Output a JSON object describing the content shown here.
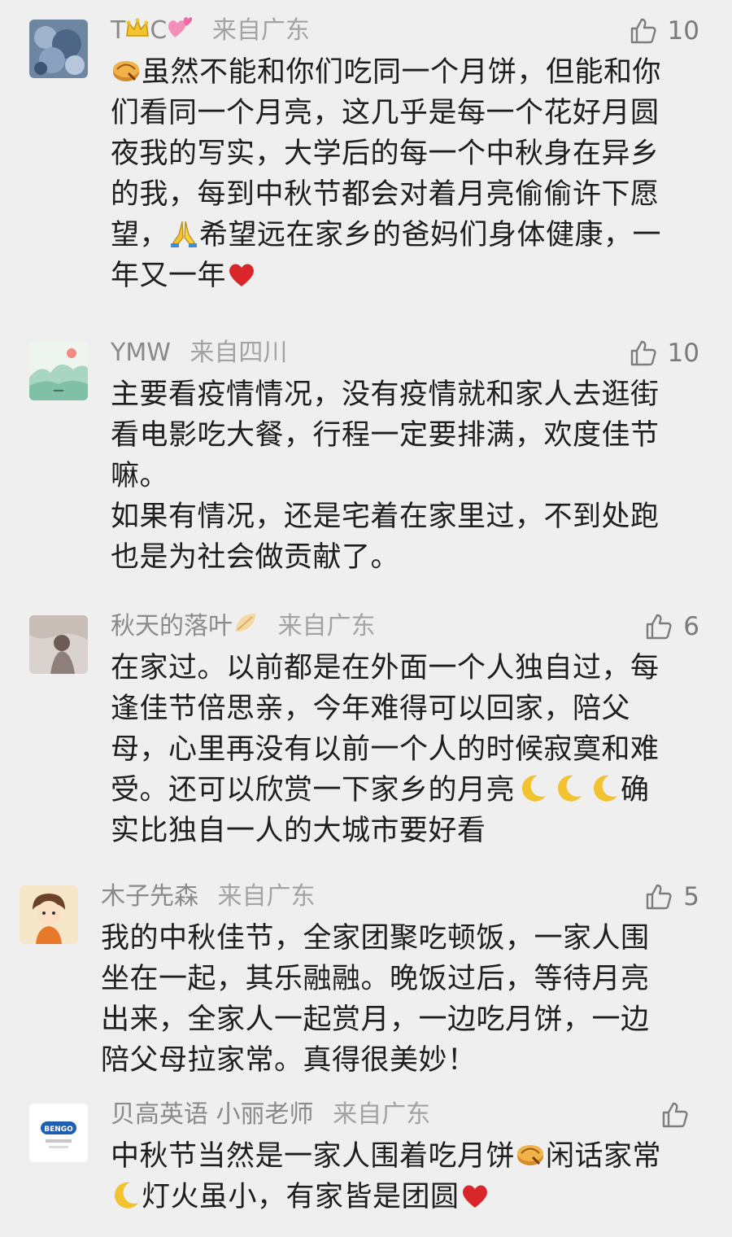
{
  "comments": [
    {
      "user": "T",
      "user_tail": "C",
      "region": "来自广东",
      "likes": "10",
      "icons": [
        "crown-icon",
        "hearts-icon",
        "mooncake-icon",
        "pray-hands-icon",
        "red-heart-icon"
      ],
      "lines": [
        "虽然不能和你们吃同一个月饼，但能和你",
        "们看同一个月亮，这几乎是每一个花好月圆",
        "夜我的写实，大学后的每一个中秋身在异乡",
        "的我，每到中秋节都会对着月亮偷偷许下愿",
        "望，",
        "希望远在家乡的爸妈们身体健康，一",
        "年又一年"
      ]
    },
    {
      "user": "YMW",
      "region": "来自四川",
      "likes": "10",
      "lines": [
        "主要看疫情情况，没有疫情就和家人去逛街",
        "看电影吃大餐，行程一定要排满，欢度佳节",
        "嘛。",
        "如果有情况，还是宅着在家里过，不到处跑",
        "也是为社会做贡献了。"
      ]
    },
    {
      "user": "秋天的落叶",
      "region": "来自广东",
      "likes": "6",
      "icons": [
        "leaf-icon",
        "crescent-moon-icon"
      ],
      "lines": [
        "在家过。以前都是在外面一个人独自过，每",
        "逢佳节倍思亲，今年难得可以回家，陪父",
        "母，心里再没有以前一个人的时候寂寞和难",
        "受。还可以欣赏一下家乡的月亮",
        "确",
        "实比独自一人的大城市要好看"
      ]
    },
    {
      "user": "木子先森",
      "region": "来自广东",
      "likes": "5",
      "lines": [
        "我的中秋佳节，全家团聚吃顿饭，一家人围",
        "坐在一起，其乐融融。晚饭过后，等待月亮",
        "出来，全家人一起赏月，一边吃月饼，一边",
        "陪父母拉家常。真得很美妙！"
      ]
    },
    {
      "user": "贝高英语 小丽老师",
      "region": "来自广东",
      "likes": "",
      "avatar_text": "BENGO",
      "lines": [
        "中秋节当然是一家人围着吃月饼",
        "闲话家常",
        "灯火虽小，有家皆是团圆"
      ]
    }
  ],
  "colors": {
    "background": "#efefef",
    "meta": "#8a8a8a",
    "text": "#1e1e1e",
    "heart": "#d9262b",
    "moon": "#f2c230"
  }
}
